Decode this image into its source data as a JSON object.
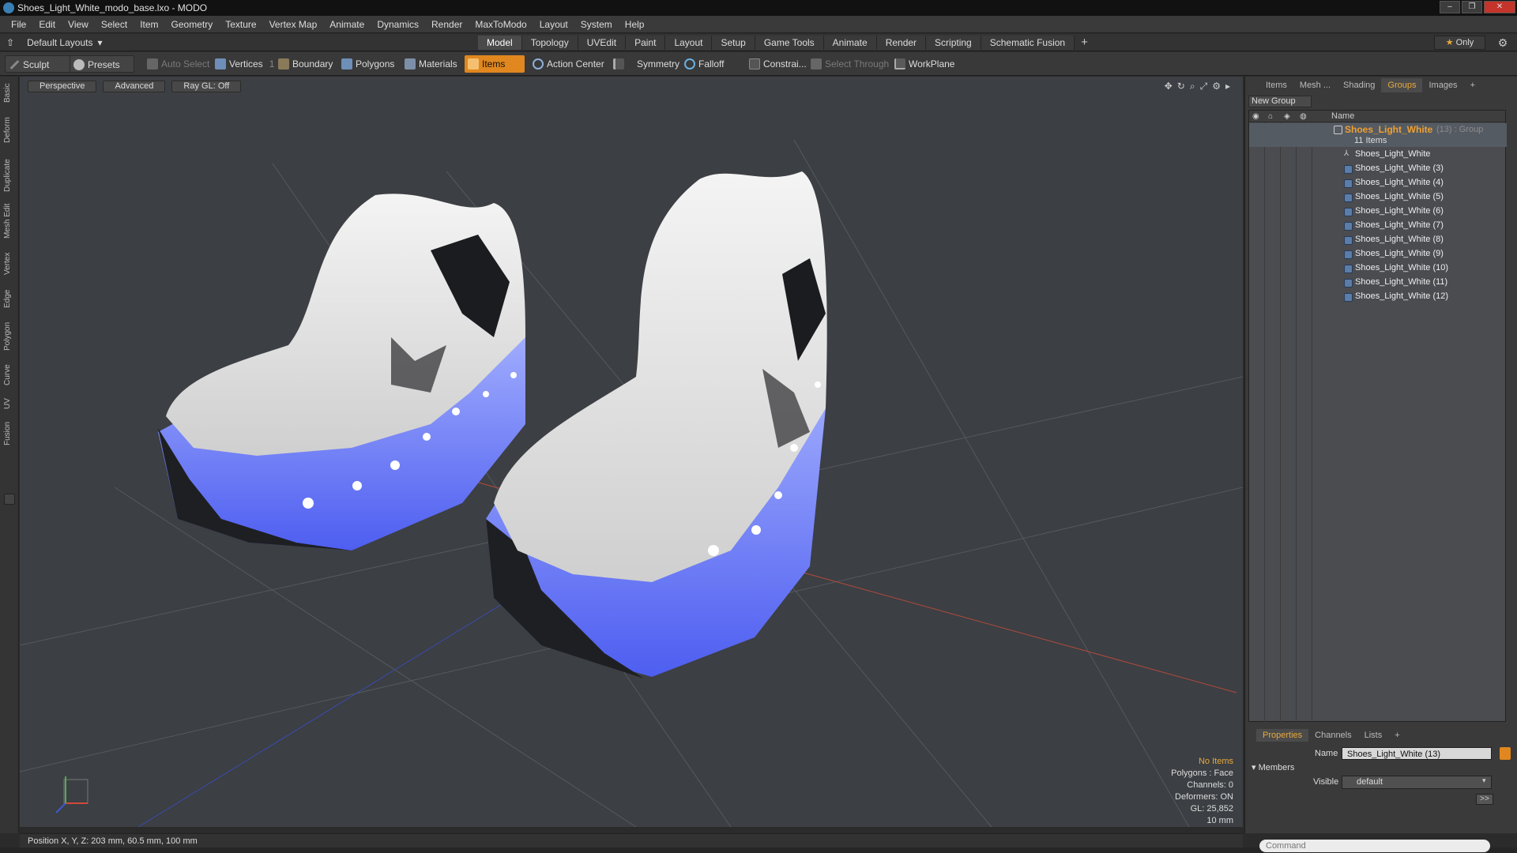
{
  "window": {
    "title": "Shoes_Light_White_modo_base.lxo - MODO",
    "controls": [
      "–",
      "❐",
      "✕"
    ]
  },
  "menu": [
    "File",
    "Edit",
    "View",
    "Select",
    "Item",
    "Geometry",
    "Texture",
    "Vertex Map",
    "Animate",
    "Dynamics",
    "Render",
    "MaxToModo",
    "Layout",
    "System",
    "Help"
  ],
  "layout": {
    "label": "Default Layouts",
    "tabs": [
      "Model",
      "Topology",
      "UVEdit",
      "Paint",
      "Layout",
      "Setup",
      "Game Tools",
      "Animate",
      "Render",
      "Scripting",
      "Schematic Fusion"
    ],
    "active_tab": "Model",
    "plus": "+",
    "only": "Only"
  },
  "toolbar": {
    "sculpt": "Sculpt",
    "presets": "Presets",
    "auto_select": "Auto Select",
    "vertices": "Vertices",
    "vertices_count": "1",
    "boundary": "Boundary",
    "polygons": "Polygons",
    "materials": "Materials",
    "items": "Items",
    "action_center": "Action Center",
    "symmetry": "Symmetry",
    "falloff": "Falloff",
    "constraints": "Constrai...",
    "select_through": "Select Through",
    "workplane": "WorkPlane"
  },
  "left_tabs": [
    "Basic",
    "Deform",
    "Duplicate",
    "Mesh Edit",
    "Vertex",
    "Edge",
    "Polygon",
    "Curve",
    "UV",
    "Fusion"
  ],
  "viewport": {
    "perspective": "Perspective",
    "advanced": "Advanced",
    "raygl": "Ray GL: Off",
    "info": {
      "no_items": "No Items",
      "polygons": "Polygons : Face",
      "channels": "Channels: 0",
      "deformers": "Deformers: ON",
      "gl": "GL: 25,852",
      "scale": "10 mm"
    }
  },
  "status": {
    "position": "Position X, Y, Z:  203 mm, 60.5 mm, 100 mm"
  },
  "right_panel": {
    "tabs": [
      "Items",
      "Mesh ...",
      "Shading",
      "Groups",
      "Images"
    ],
    "active_tab": "Groups",
    "new_group": "New Group",
    "tree_header": "Name",
    "group": {
      "name": "Shoes_Light_White",
      "suffix": "(13) : Group",
      "count": "11 Items"
    },
    "items": [
      "Shoes_Light_White",
      "Shoes_Light_White (3)",
      "Shoes_Light_White (4)",
      "Shoes_Light_White (5)",
      "Shoes_Light_White (6)",
      "Shoes_Light_White (7)",
      "Shoes_Light_White (8)",
      "Shoes_Light_White (9)",
      "Shoes_Light_White (10)",
      "Shoes_Light_White (11)",
      "Shoes_Light_White (12)"
    ],
    "props_tabs": [
      "Properties",
      "Channels",
      "Lists",
      "+"
    ],
    "props": {
      "name_label": "Name",
      "name_value": "Shoes_Light_White (13)",
      "members": "Members",
      "visible_label": "Visible",
      "visible_value": "default",
      "expand": ">>"
    },
    "command_placeholder": "Command"
  },
  "colors": {
    "accent": "#e0871f",
    "group_name": "#f0a030",
    "led_blue": "#5d6ff0"
  }
}
